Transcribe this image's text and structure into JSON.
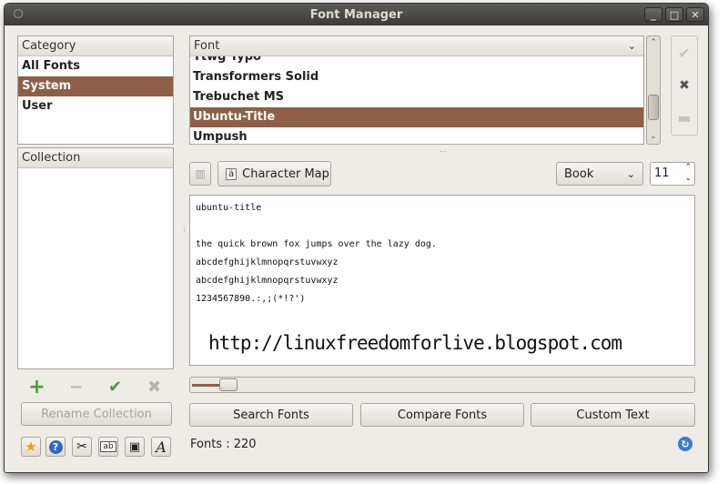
{
  "window": {
    "title": "Font Manager",
    "buttons": [
      "_",
      "□",
      "✕"
    ]
  },
  "category": {
    "header": "Category",
    "items": [
      {
        "label": "All Fonts",
        "selected": false
      },
      {
        "label": "System",
        "selected": true
      },
      {
        "label": "User",
        "selected": false
      }
    ]
  },
  "collection": {
    "header": "Collection",
    "rename_label": "Rename Collection"
  },
  "font_list": {
    "header": "Font",
    "items": [
      {
        "label": "Ttwg Typo",
        "selected": false
      },
      {
        "label": "Transformers Solid",
        "selected": false
      },
      {
        "label": "Trebuchet MS",
        "selected": false
      },
      {
        "label": "Ubuntu-Title",
        "selected": true
      },
      {
        "label": "Umpush",
        "selected": false
      }
    ]
  },
  "toolbar": {
    "character_map_label": "Character Map",
    "style_value": "Book",
    "size_value": "11"
  },
  "preview": {
    "name_line": "ubuntu-title",
    "pangram_line": "the quick brown fox jumps over the lazy dog.",
    "lower_line_1": "abcdefghijklmnopqrstuvwxyz",
    "lower_line_2": "abcdefghijklmnopqrstuvwxyz",
    "numbers_line": "1234567890.:,;(*!?')",
    "watermark": "http://linuxfreedomforlive.blogspot.com"
  },
  "slider": {
    "value": 0.17
  },
  "actions": {
    "search_label": "Search Fonts",
    "compare_label": "Compare Fonts",
    "custom_label": "Custom Text"
  },
  "status": {
    "font_count": "Fonts : 220"
  },
  "colors": {
    "accent": "#8d5f47",
    "add": "#3ea52a",
    "check": "#3ea52a"
  }
}
